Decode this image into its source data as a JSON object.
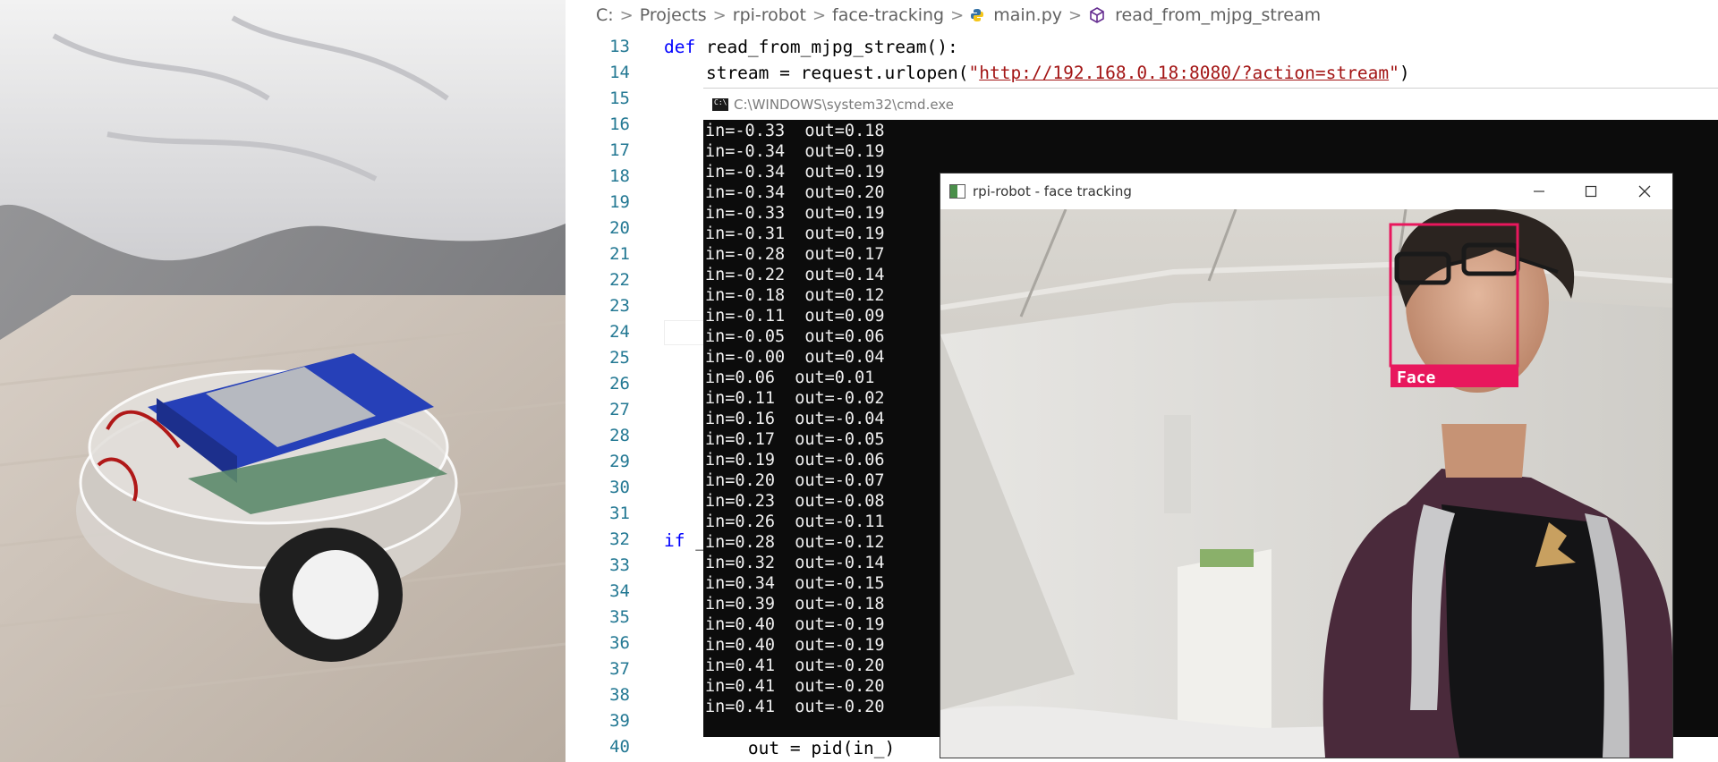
{
  "breadcrumb": {
    "items": [
      "C:",
      "Projects",
      "rpi-robot",
      "face-tracking",
      "main.py",
      "read_from_mjpg_stream"
    ],
    "separator": ">"
  },
  "editor": {
    "line_numbers": [
      "13",
      "14",
      "15",
      "16",
      "17",
      "18",
      "19",
      "20",
      "21",
      "22",
      "23",
      "24",
      "25",
      "26",
      "27",
      "28",
      "29",
      "30",
      "31",
      "32",
      "33",
      "34",
      "35",
      "36",
      "37",
      "38",
      "39",
      "40"
    ],
    "line13": {
      "keyword": "def",
      "rest": " read_from_mjpg_stream():"
    },
    "line14": {
      "before": "    stream = request.urlopen(",
      "q1": "\"",
      "url": "http://192.168.0.18:8080/?action=stream",
      "q2": "\"",
      "after": ")"
    },
    "line32": {
      "keyword": "if",
      "rest": " _"
    },
    "line40": {
      "text": "        out = pid(in_)"
    },
    "colors": {
      "keyword": "#0000ff",
      "string": "#a31515",
      "line_number": "#237893"
    }
  },
  "cmd": {
    "title": "C:\\WINDOWS\\system32\\cmd.exe",
    "lines": [
      "in=-0.33  out=0.18",
      "in=-0.34  out=0.19",
      "in=-0.34  out=0.19",
      "in=-0.34  out=0.20",
      "in=-0.33  out=0.19",
      "in=-0.31  out=0.19",
      "in=-0.28  out=0.17",
      "in=-0.22  out=0.14",
      "in=-0.18  out=0.12",
      "in=-0.11  out=0.09",
      "in=-0.05  out=0.06",
      "in=-0.00  out=0.04",
      "in=0.06  out=0.01",
      "in=0.11  out=-0.02",
      "in=0.16  out=-0.04",
      "in=0.17  out=-0.05",
      "in=0.19  out=-0.06",
      "in=0.20  out=-0.07",
      "in=0.23  out=-0.08",
      "in=0.26  out=-0.11",
      "in=0.28  out=-0.12",
      "in=0.32  out=-0.14",
      "in=0.34  out=-0.15",
      "in=0.39  out=-0.18",
      "in=0.40  out=-0.19",
      "in=0.40  out=-0.19",
      "in=0.41  out=-0.20",
      "in=0.41  out=-0.20",
      "in=0.41  out=-0.20"
    ]
  },
  "face_window": {
    "title": "rpi-robot - face tracking",
    "minimize_icon": "minimize-icon",
    "maximize_icon": "maximize-icon",
    "close_icon": "close-icon",
    "detection_label": "Face",
    "detection_color": "#e8175d"
  }
}
